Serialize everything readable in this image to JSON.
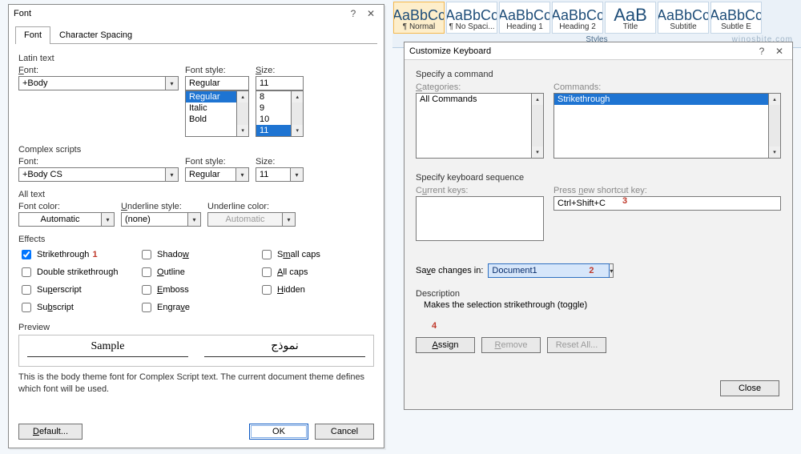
{
  "ribbon": {
    "styles": [
      {
        "big": "AaBbCc",
        "label": "¶ Normal",
        "selected": true
      },
      {
        "big": "AaBbCc",
        "label": "¶ No Spaci..."
      },
      {
        "big": "AaBbCc",
        "label": "Heading 1"
      },
      {
        "big": "AaBbCc",
        "label": "Heading 2"
      },
      {
        "big": "AaB",
        "label": "Title"
      },
      {
        "big": "AaBbCc",
        "label": "Subtitle"
      },
      {
        "big": "AaBbCc",
        "label": "Subtle E"
      }
    ],
    "group_label": "Styles",
    "watermark": "winosbite.com"
  },
  "font_dialog": {
    "title": "Font",
    "tabs": {
      "font": "Font",
      "spacing": "Character Spacing"
    },
    "latin_label": "Latin text",
    "font_label": "Font:",
    "font_value": "+Body",
    "font_style_label": "Font style:",
    "font_style_value": "Regular",
    "font_style_list": [
      "Regular",
      "Italic",
      "Bold"
    ],
    "size_label": "Size:",
    "size_value": "11",
    "size_list": [
      "8",
      "9",
      "10",
      "11"
    ],
    "complex_label": "Complex scripts",
    "complex_font_value": "+Body CS",
    "complex_style_value": "Regular",
    "complex_size_value": "11",
    "alltext_label": "All text",
    "font_color_label": "Font color:",
    "font_color_value": "Automatic",
    "underline_style_label": "Underline style:",
    "underline_style_value": "(none)",
    "underline_color_label": "Underline color:",
    "underline_color_value": "Automatic",
    "effects_label": "Effects",
    "effects": {
      "strikethrough": "Strikethrough",
      "double_strike": "Double strikethrough",
      "superscript": "Superscript",
      "subscript": "Subscript",
      "shadow": "Shadow",
      "outline": "Outline",
      "emboss": "Emboss",
      "engrave": "Engrave",
      "smallcaps": "Small caps",
      "allcaps": "All caps",
      "hidden": "Hidden"
    },
    "marker1": "1",
    "preview_label": "Preview",
    "preview_left": "Sample",
    "preview_right": "نموذج",
    "preview_desc": "This is the body theme font for Complex Script text. The current document theme defines which font will be used.",
    "default_btn": "Default...",
    "ok_btn": "OK",
    "cancel_btn": "Cancel"
  },
  "kb_dialog": {
    "title": "Customize Keyboard",
    "specify_cmd": "Specify a command",
    "categories_label": "Categories:",
    "categories_value": "All Commands",
    "commands_label": "Commands:",
    "commands_value": "Strikethrough",
    "specify_seq": "Specify keyboard sequence",
    "current_keys_label": "Current keys:",
    "press_new_label": "Press new shortcut key:",
    "press_new_value": "Ctrl+Shift+C",
    "marker3": "3",
    "save_in_label": "Save changes in:",
    "save_in_value": "Document1",
    "marker2": "2",
    "description_label": "Description",
    "description_text": "Makes the selection strikethrough (toggle)",
    "marker4": "4",
    "assign_btn": "Assign",
    "remove_btn": "Remove",
    "resetall_btn": "Reset All...",
    "close_btn": "Close"
  }
}
